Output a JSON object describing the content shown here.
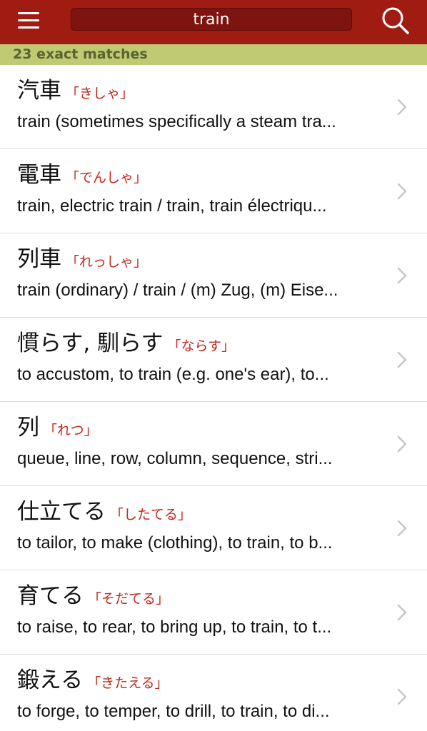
{
  "search": {
    "query": "train"
  },
  "status": {
    "match_count": "23 exact matches"
  },
  "results": [
    {
      "kanji": "汽車",
      "reading": "「きしゃ」",
      "gloss": "train (sometimes specifically a steam tra..."
    },
    {
      "kanji": "電車",
      "reading": "「でんしゃ」",
      "gloss": "train, electric train / train, train électriqu..."
    },
    {
      "kanji": "列車",
      "reading": "「れっしゃ」",
      "gloss": "train (ordinary) / train / (m) Zug, (m) Eise..."
    },
    {
      "kanji": "慣らす, 馴らす",
      "reading": "「ならす」",
      "gloss": "to accustom, to train (e.g. one's ear), to..."
    },
    {
      "kanji": "列",
      "reading": "「れつ」",
      "gloss": "queue, line, row, column, sequence, stri..."
    },
    {
      "kanji": "仕立てる",
      "reading": "「したてる」",
      "gloss": "to tailor, to make (clothing), to train, to b..."
    },
    {
      "kanji": "育てる",
      "reading": "「そだてる」",
      "gloss": "to raise, to rear, to bring up, to train, to t..."
    },
    {
      "kanji": "鍛える",
      "reading": "「きたえる」",
      "gloss": "to forge, to temper, to drill, to train, to di..."
    }
  ],
  "icons": {
    "menu": "hamburger-menu-icon",
    "search": "search-icon",
    "row": "chevron-right-icon"
  },
  "colors": {
    "header": "#a01b12",
    "match_bar": "#bfca73",
    "reading": "#c0281c"
  }
}
